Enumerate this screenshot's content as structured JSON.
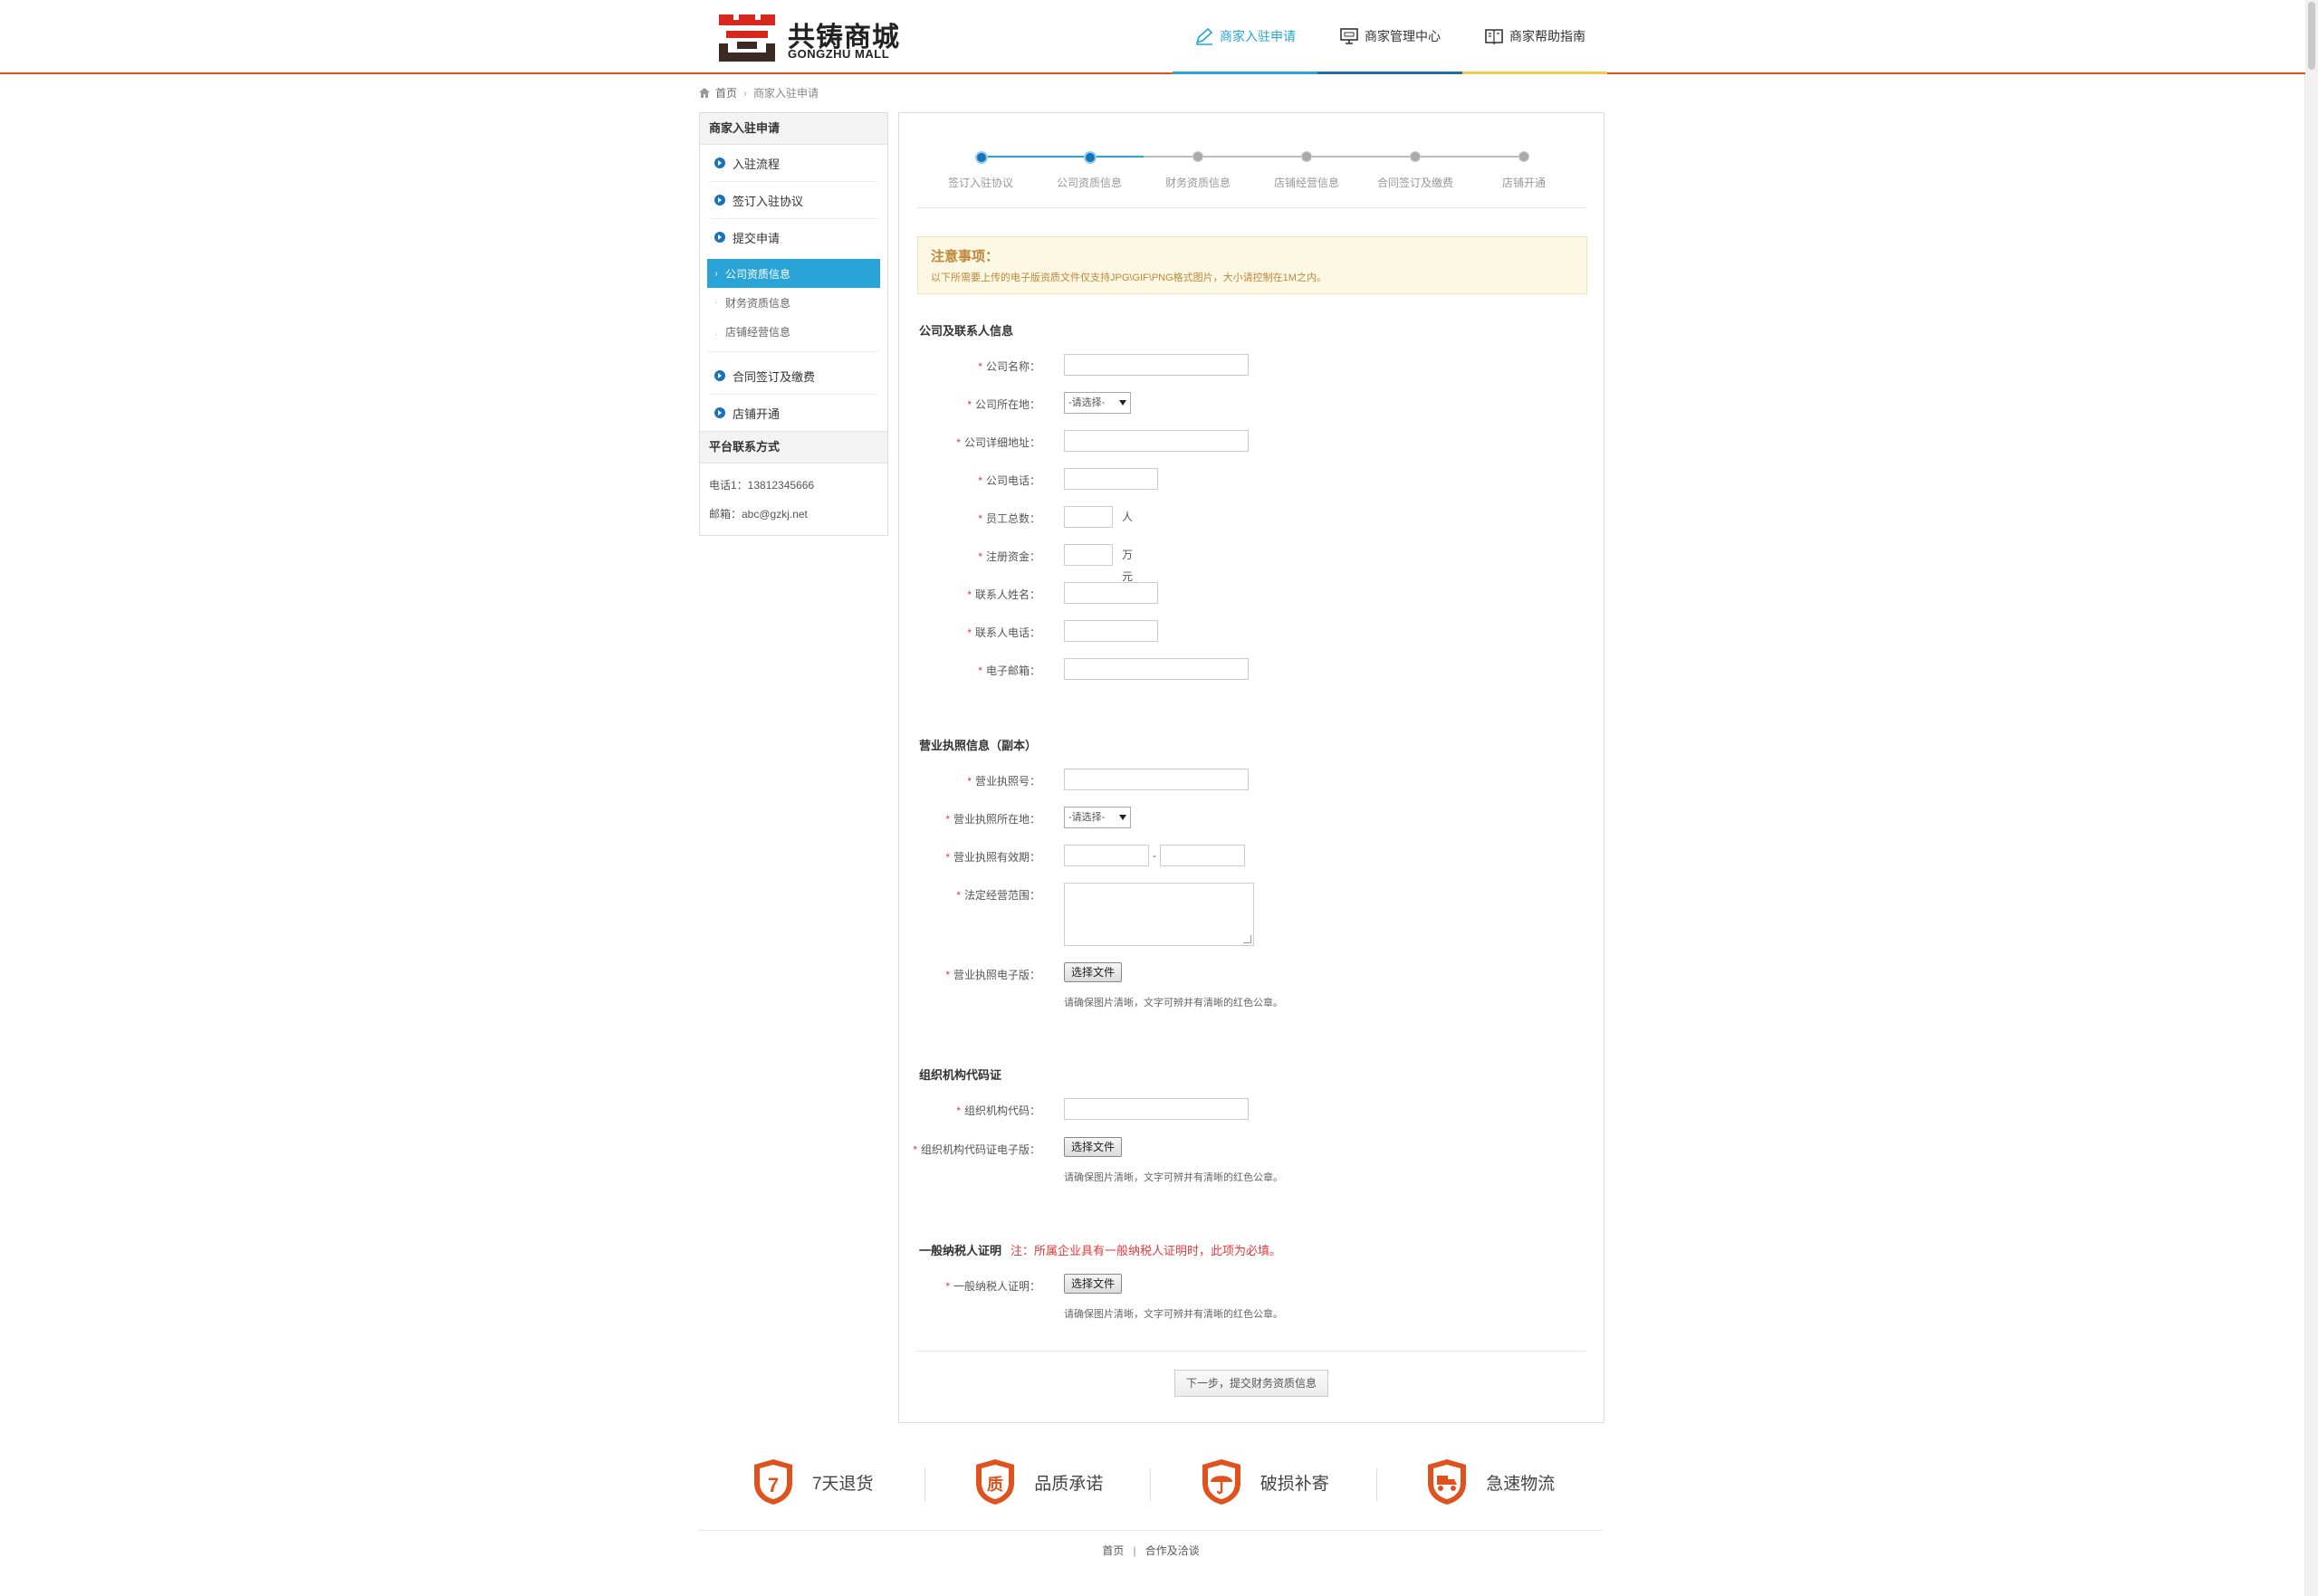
{
  "brand": {
    "name_cn": "共铸商城",
    "name_en": "GONGZHU MALL",
    "accent": "#e0521d",
    "highlight": "#2aa3d7"
  },
  "nav": {
    "items": [
      {
        "label": "商家入驻申请",
        "icon": "pen-icon",
        "active": true,
        "color": "#2aa3d7"
      },
      {
        "label": "商家管理中心",
        "icon": "monitor-icon",
        "active": false,
        "color": "#1f6fa3"
      },
      {
        "label": "商家帮助指南",
        "icon": "book-icon",
        "active": false,
        "color": "#f2c94c"
      }
    ]
  },
  "breadcrumb": {
    "home": "首页",
    "current": "商家入驻申请"
  },
  "sidebar": {
    "title": "商家入驻申请",
    "items": [
      "入驻流程",
      "签订入驻协议",
      "提交申请"
    ],
    "sub_items": [
      "公司资质信息",
      "财务资质信息",
      "店铺经营信息"
    ],
    "items_after": [
      "合同签订及缴费",
      "店铺开通"
    ],
    "contact_title": "平台联系方式",
    "phone": "电话1：13812345666",
    "email": "邮箱：abc@gzkj.net"
  },
  "steps": {
    "labels": [
      "签订入驻协议",
      "公司资质信息",
      "财务资质信息",
      "店铺经营信息",
      "合同签订及缴费",
      "店铺开通"
    ],
    "current_step": 2
  },
  "notice": {
    "title": "注意事项：",
    "text": "以下所需要上传的电子版资质文件仅支持JPG\\GIF\\PNG格式图片，大小请控制在1M之内。"
  },
  "section_company": {
    "title": "公司及联系人信息",
    "labels": {
      "company_name": "公司名称：",
      "location": "公司所在地：",
      "address": "公司详细地址：",
      "phone": "公司电话：",
      "employees": "员工总数：",
      "capital": "注册资金：",
      "contact_name": "联系人姓名：",
      "contact_phone": "联系人电话：",
      "email": "电子邮箱："
    },
    "select_placeholder": "-请选择-",
    "unit_people": "人",
    "unit_money": "万元"
  },
  "section_license": {
    "title": "营业执照信息（副本）",
    "labels": {
      "number": "营业执照号：",
      "location": "营业执照所在地：",
      "validity": "营业执照有效期：",
      "scope": "法定经营范围：",
      "file": "营业执照电子版："
    },
    "select_placeholder": "-请选择-",
    "date_sep": "-",
    "file_button": "选择文件",
    "hint": "请确保图片清晰，文字可辨并有清晰的红色公章。"
  },
  "section_org": {
    "title": "组织机构代码证",
    "labels": {
      "code": "组织机构代码：",
      "file": "组织机构代码证电子版："
    },
    "file_button": "选择文件",
    "hint": "请确保图片清晰，文字可辨并有清晰的红色公章。"
  },
  "section_tax": {
    "title": "一般纳税人证明",
    "note": "注：所属企业具有一般纳税人证明时，此项为必填。",
    "labels": {
      "file": "一般纳税人证明："
    },
    "file_button": "选择文件",
    "hint": "请确保图片清晰，文字可辨并有清晰的红色公章。"
  },
  "required_mark": "*",
  "next_button": "下一步，提交财务资质信息",
  "features": [
    {
      "label": "7天退货",
      "icon": "seven-day-return-icon",
      "glyph": "7"
    },
    {
      "label": "品质承诺",
      "icon": "quality-icon",
      "glyph": "质"
    },
    {
      "label": "破损补寄",
      "icon": "umbrella-icon",
      "glyph": "☂"
    },
    {
      "label": "急速物流",
      "icon": "delivery-icon",
      "glyph": "🛵"
    }
  ],
  "footer": {
    "links": [
      "首页",
      "合作及洽谈"
    ],
    "separator": "|"
  }
}
